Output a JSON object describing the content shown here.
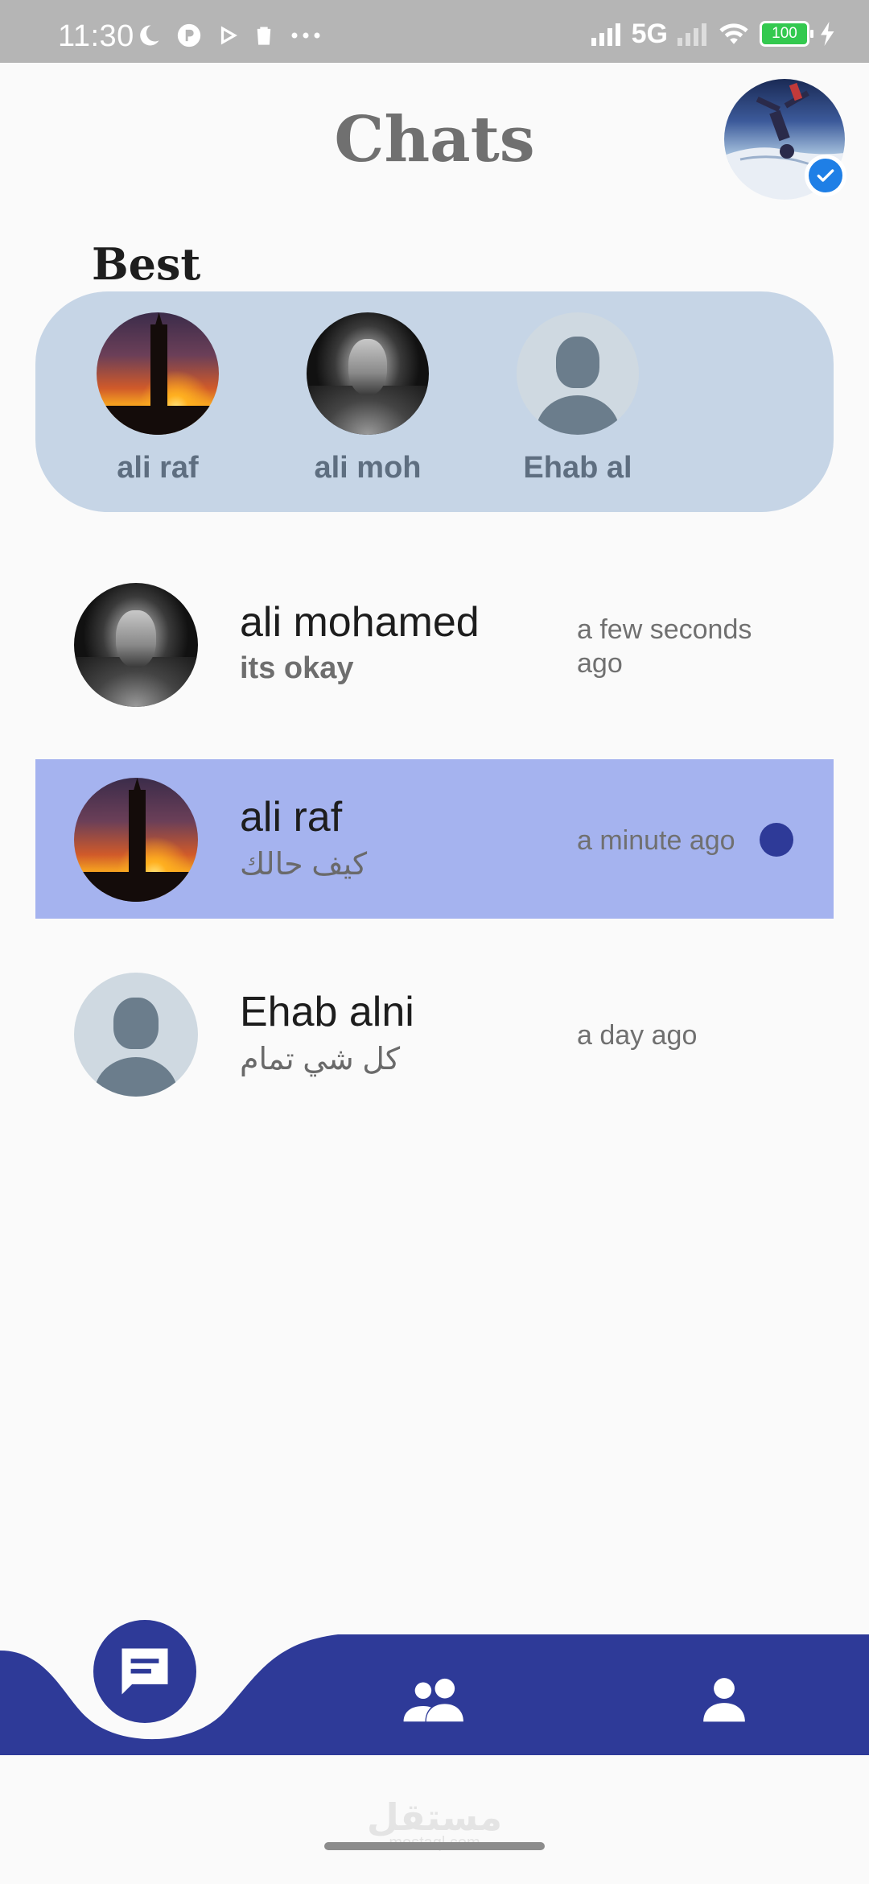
{
  "status_bar": {
    "time": "11:30",
    "network": "5G",
    "battery": "100",
    "icons": [
      "moon-icon",
      "app-icon",
      "play-icon",
      "trash-icon",
      "more-icon",
      "signal-icon",
      "signal-weak-icon",
      "wifi-icon",
      "battery-icon",
      "charging-icon"
    ]
  },
  "header": {
    "title": "Chats",
    "profile_icon": "verified-check-icon"
  },
  "best": {
    "label": "Best",
    "items": [
      {
        "name": "ali raf",
        "avatar": "big-ben-sunset"
      },
      {
        "name": "ali moh",
        "avatar": "viking-portrait"
      },
      {
        "name": "Ehab al",
        "avatar": "default-person"
      }
    ]
  },
  "chats": [
    {
      "name": "ali mohamed",
      "message": "its okay",
      "time": "a few seconds ago",
      "unread": false
    },
    {
      "name": "ali raf",
      "message": "كيف حالك",
      "time": "a minute ago",
      "unread": true
    },
    {
      "name": "Ehab alni",
      "message": "كل شي تمام",
      "time": "a day ago",
      "unread": false
    }
  ],
  "bottom_nav": {
    "items": [
      "chat-icon",
      "group-icon",
      "person-icon"
    ],
    "active": "chat-icon"
  },
  "watermark": {
    "arabic": "مستقل",
    "latin": "mostaql.com"
  },
  "colors": {
    "accent": "#2e3a98",
    "best_panel": "#c6d5e6",
    "unread_row": "#a5b3ef",
    "status_bar": "#b5b5b5",
    "verified": "#1f7fe6"
  }
}
